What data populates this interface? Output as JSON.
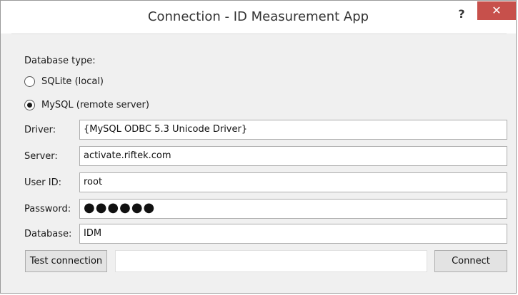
{
  "window": {
    "title": "Connection - ID Measurement App",
    "help_label": "?",
    "close_label": "✕"
  },
  "database_type": {
    "label": "Database type:",
    "options": [
      {
        "label": "SQLite (local)",
        "selected": false
      },
      {
        "label": "MySQL (remote server)",
        "selected": true
      }
    ]
  },
  "fields": {
    "driver": {
      "label": "Driver:",
      "value": "{MySQL ODBC 5.3 Unicode Driver}"
    },
    "server": {
      "label": "Server:",
      "value": "activate.riftek.com"
    },
    "user_id": {
      "label": "User ID:",
      "value": "root"
    },
    "password": {
      "label": "Password:",
      "value": "●●●●●●"
    },
    "database": {
      "label": "Database:",
      "value": "IDM"
    }
  },
  "actions": {
    "test_connection_label": "Test connection",
    "status_text": "",
    "connect_label": "Connect"
  }
}
